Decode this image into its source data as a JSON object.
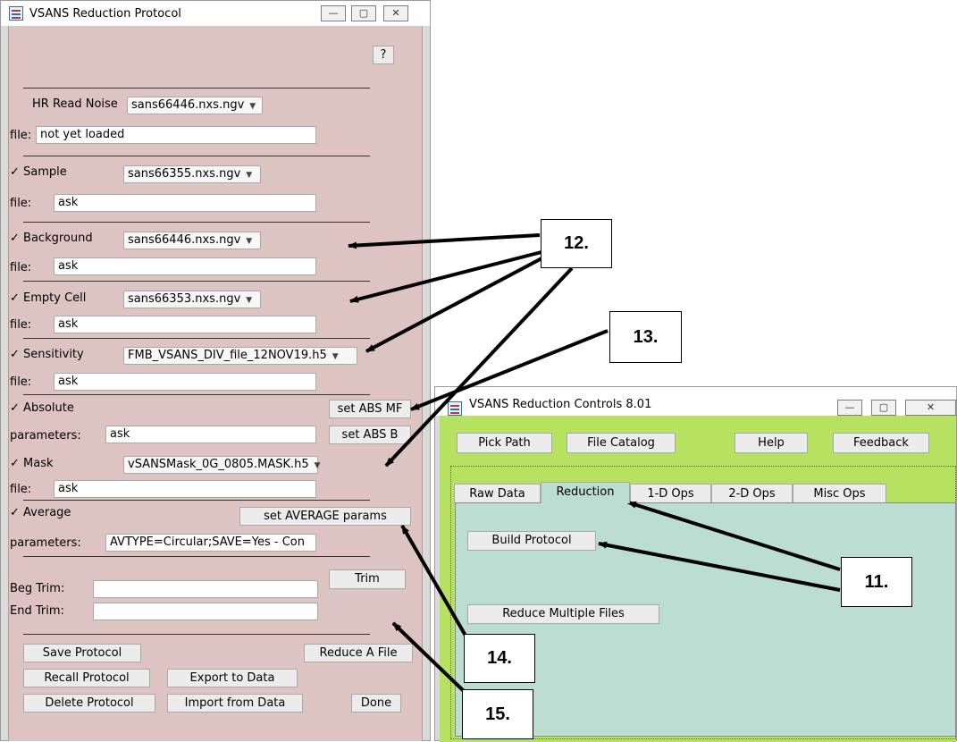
{
  "protocol_window": {
    "title": "VSANS Reduction Protocol",
    "help_label": "?",
    "read_noise": {
      "label": "HR Read Noise",
      "popup": "sans66446.nxs.ngv",
      "file_label": "file:",
      "file_value": "not yet loaded"
    },
    "sample": {
      "check": "✓",
      "label": "Sample",
      "popup": "sans66355.nxs.ngv",
      "file_label": "file:",
      "file_value": "ask"
    },
    "background": {
      "check": "✓",
      "label": "Background",
      "popup": "sans66446.nxs.ngv",
      "file_label": "file:",
      "file_value": "ask"
    },
    "empty_cell": {
      "check": "✓",
      "label": "Empty Cell",
      "popup": "sans66353.nxs.ngv",
      "file_label": "file:",
      "file_value": "ask"
    },
    "sensitivity": {
      "check": "✓",
      "label": "Sensitivity",
      "popup": "FMB_VSANS_DIV_file_12NOV19.h5",
      "file_label": "file:",
      "file_value": "ask"
    },
    "absolute": {
      "check": "✓",
      "label": "Absolute",
      "btn_mf": "set ABS MF",
      "params_label": "parameters:",
      "params_value": "ask",
      "btn_b": "set ABS B"
    },
    "mask": {
      "check": "✓",
      "label": "Mask",
      "popup": "vSANSMask_0G_0805.MASK.h5",
      "file_label": "file:",
      "file_value": "ask"
    },
    "average": {
      "check": "✓",
      "label": "Average",
      "btn": "set AVERAGE params",
      "params_label": "parameters:",
      "params_value": "AVTYPE=Circular;SAVE=Yes - Con"
    },
    "trim": {
      "beg_label": "Beg Trim:",
      "end_label": "End Trim:",
      "btn": "Trim"
    },
    "buttons": {
      "save": "Save Protocol",
      "reduce": "Reduce A File",
      "recall": "Recall Protocol",
      "export": "Export to Data",
      "delete": "Delete Protocol",
      "import": "Import from Data",
      "done": "Done"
    }
  },
  "controls_window": {
    "title": "VSANS Reduction Controls 8.01",
    "buttons": {
      "pick_path": "Pick Path",
      "file_catalog": "File Catalog",
      "help": "Help",
      "feedback": "Feedback"
    },
    "tabs": [
      "Raw Data",
      "Reduction",
      "1-D Ops",
      "2-D Ops",
      "Misc Ops"
    ],
    "active_tab": "Reduction",
    "build_protocol": "Build Protocol",
    "reduce_multiple": "Reduce Multiple Files"
  },
  "callouts": {
    "c11": "11.",
    "c12": "12.",
    "c13": "13.",
    "c14": "14.",
    "c15": "15."
  },
  "window_glyphs": {
    "minimize": "—",
    "maximize": "▢",
    "close": "✕"
  },
  "popup_chevron": "▼"
}
